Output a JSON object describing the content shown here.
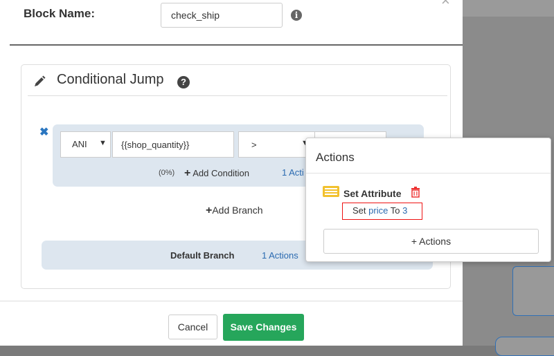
{
  "modal": {
    "block_name_label": "Block Name:",
    "block_name_value": "check_ship",
    "close_glyph": "×"
  },
  "panel": {
    "title": "Conditional Jump",
    "branch": {
      "remove_glyph": "✖",
      "logic_value": "ANI",
      "condition_value": "{{shop_quantity}}",
      "operator_value": ">",
      "percent": "(0%)",
      "add_condition_label": "Add Condition",
      "actions_link": "1 Acti"
    },
    "add_branch_label": "Add Branch",
    "default_branch": {
      "label": "Default Branch",
      "actions_link": "1 Actions"
    }
  },
  "footer": {
    "cancel_label": "Cancel",
    "save_label": "Save Changes"
  },
  "popover": {
    "title": "Actions",
    "item": {
      "title": "Set Attribute",
      "prefix": "Set",
      "attribute": "price",
      "middle": "To",
      "value": "3"
    },
    "add_actions_label": "+ Actions"
  },
  "colors": {
    "primary_green": "#26a65b",
    "link_blue": "#2a6ab0",
    "branch_bg": "#dde6ef",
    "highlight_red": "#e11",
    "attr_icon_yellow": "#f2c12e"
  },
  "icons": [
    "close-icon",
    "info-icon",
    "pencil-icon",
    "help-icon",
    "remove-branch-icon",
    "chevron-down-icon",
    "plus-icon",
    "attribute-list-icon",
    "trash-icon"
  ]
}
